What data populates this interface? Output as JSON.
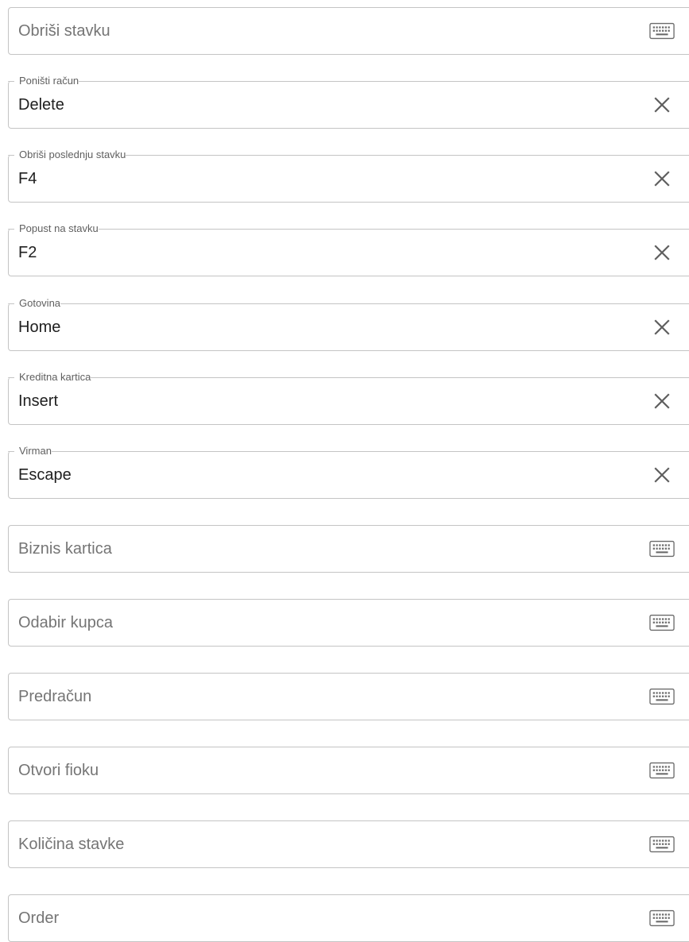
{
  "shortcuts": [
    {
      "label": "Obriši stavku",
      "value": "",
      "icon": "keyboard-icon"
    },
    {
      "label": "Poništi račun",
      "value": "Delete",
      "icon": "close-icon"
    },
    {
      "label": "Obriši poslednju stavku",
      "value": "F4",
      "icon": "close-icon"
    },
    {
      "label": "Popust na stavku",
      "value": "F2",
      "icon": "close-icon"
    },
    {
      "label": "Gotovina",
      "value": "Home",
      "icon": "close-icon"
    },
    {
      "label": "Kreditna kartica",
      "value": "Insert",
      "icon": "close-icon"
    },
    {
      "label": "Virman",
      "value": "Escape",
      "icon": "close-icon"
    },
    {
      "label": "Biznis kartica",
      "value": "",
      "icon": "keyboard-icon"
    },
    {
      "label": "Odabir kupca",
      "value": "",
      "icon": "keyboard-icon"
    },
    {
      "label": "Predračun",
      "value": "",
      "icon": "keyboard-icon"
    },
    {
      "label": "Otvori fioku",
      "value": "",
      "icon": "keyboard-icon"
    },
    {
      "label": "Količina stavke",
      "value": "",
      "icon": "keyboard-icon"
    },
    {
      "label": "Order",
      "value": "",
      "icon": "keyboard-icon"
    }
  ],
  "colors": {
    "border": "#c4c4c4",
    "placeholder": "#757575",
    "value": "#202020",
    "label": "#5f5f5f",
    "icon": "#5f5f5f"
  }
}
